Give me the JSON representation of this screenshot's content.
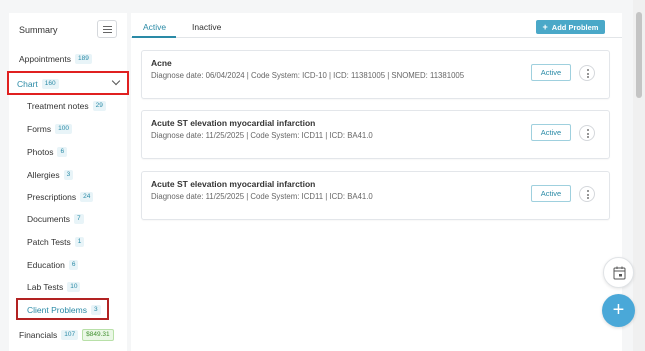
{
  "sidebar": {
    "summary_label": "Summary",
    "items": [
      {
        "label": "Appointments",
        "count": "189"
      },
      {
        "label": "Chart",
        "count": "160"
      },
      {
        "label": "Treatment notes",
        "count": "29"
      },
      {
        "label": "Forms",
        "count": "100"
      },
      {
        "label": "Photos",
        "count": "6"
      },
      {
        "label": "Allergies",
        "count": "3"
      },
      {
        "label": "Prescriptions",
        "count": "24"
      },
      {
        "label": "Documents",
        "count": "7"
      },
      {
        "label": "Patch Tests",
        "count": "1"
      },
      {
        "label": "Education",
        "count": "6"
      },
      {
        "label": "Lab Tests",
        "count": "10"
      },
      {
        "label": "Client Problems",
        "count": "3"
      },
      {
        "label": "Financials",
        "count": "107",
        "amount": "$849.31"
      }
    ]
  },
  "tabs": [
    {
      "label": "Active"
    },
    {
      "label": "Inactive"
    }
  ],
  "add_button_label": "Add Problem",
  "problems": [
    {
      "title": "Acne",
      "meta": "Diagnose date: 06/04/2024 | Code System: ICD-10 | ICD: 11381005 | SNOMED: 11381005",
      "status": "Active"
    },
    {
      "title": "Acute ST elevation myocardial infarction",
      "meta": "Diagnose date: 11/25/2025 | Code System: ICD11 | ICD: BA41.0",
      "status": "Active"
    },
    {
      "title": "Acute ST elevation myocardial infarction",
      "meta": "Diagnose date: 11/25/2025 | Code System: ICD11 | ICD: BA41.0",
      "status": "Active"
    }
  ],
  "icons": {
    "collapse": "list-collapse-icon",
    "chevron": "chevron-down-icon",
    "plus": "plus-icon",
    "kebab": "more-vertical-icon",
    "calendar": "calendar-icon"
  },
  "colors": {
    "accent": "#2a8aa6",
    "add_button": "#4aa8c8",
    "fab": "#4aa8d8",
    "highlight_box": "#e02020"
  }
}
